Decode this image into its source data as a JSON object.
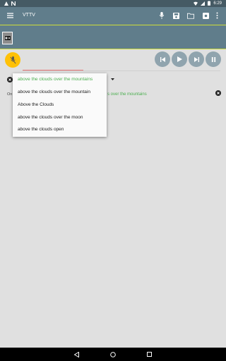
{
  "status_bar": {
    "time": "6:29",
    "left_icons": [
      "alert-icon",
      "n-icon"
    ],
    "right_icons": [
      "wifi-icon",
      "signal-icon",
      "battery-icon"
    ]
  },
  "app_bar": {
    "title": "VTTV",
    "icons": [
      "menu-icon",
      "microphone-icon",
      "save-icon",
      "folder-icon",
      "settings-icon",
      "more-vert-icon"
    ],
    "colors": {
      "primary": "#607d8b",
      "dark": "#455a64"
    }
  },
  "transport": {
    "buttons": [
      "skip-previous-icon",
      "play-icon",
      "skip-next-icon",
      "pause-icon"
    ],
    "mic_color": "#ffc107",
    "button_color": "#90a4ae"
  },
  "result": {
    "label": "On",
    "text": "s over the mountains",
    "color": "#4caf50"
  },
  "suggestions": {
    "selected_index": 0,
    "items": [
      "above the clouds over the mountains",
      "above the clouds over the mountain",
      "Above the Clouds",
      "above the clouds over the moon",
      "above the clouds open"
    ]
  },
  "nav_bar": {
    "icons": [
      "back-icon",
      "home-icon",
      "recents-icon"
    ]
  }
}
